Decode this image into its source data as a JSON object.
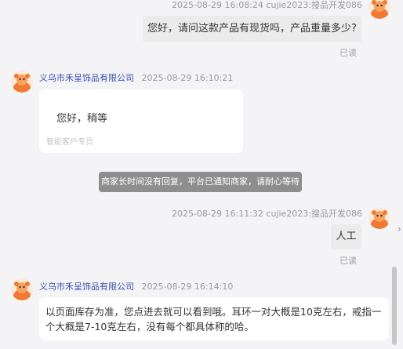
{
  "colors": {
    "background": "#f4f4f6",
    "merchant_name": "#3b4fae",
    "my_bubble": "#ebebeb",
    "their_bubble": "#ffffff",
    "system_notice": "#8e8e8e"
  },
  "messages": [
    {
      "side": "right",
      "sender": "cujie2023:搜品开发086",
      "time": "2025-08-29 16:08:24",
      "text": "您好，请问这款产品有现货吗，产品重量多少?",
      "status": "已读"
    },
    {
      "side": "left",
      "sender": "义乌市禾呈饰品有限公司",
      "time": "2025-08-29 16:10:21",
      "text": "您好，稍等",
      "footer": "智能客户专员"
    },
    {
      "side": "system",
      "text": "商家长时间没有回复，平台已通知商家，请耐心等待"
    },
    {
      "side": "right",
      "sender": "cujie2023:搜品开发086",
      "time": "2025-08-29 16:11:32",
      "text": "人工",
      "status": "已读"
    },
    {
      "side": "left",
      "sender": "义乌市禾呈饰品有限公司",
      "time": "2025-08-29 16:14:10",
      "text": "以页面库存为准，您点进去就可以看到哦。耳环一对大概是10克左右，戒指一个大概是7-10克左右，没有每个都具体称的哈。"
    }
  ],
  "icons": {
    "avatar": "cartoon-mascot-avatar",
    "expand": "chevron-right-icon"
  }
}
